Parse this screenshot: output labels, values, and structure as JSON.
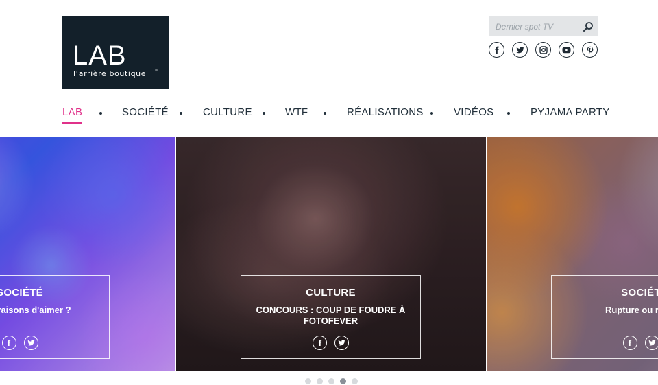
{
  "logo": {
    "main": "LAB",
    "sub": "l’arrière boutique",
    "reg": "®",
    "bg": "#13202a"
  },
  "search": {
    "placeholder": "Dernier spot TV",
    "icon": "search-icon"
  },
  "social": [
    "facebook-icon",
    "twitter-icon",
    "instagram-icon",
    "youtube-icon",
    "pinterest-icon"
  ],
  "nav": {
    "items": [
      {
        "label": "LAB",
        "active": true
      },
      {
        "label": "SOCIÉTÉ"
      },
      {
        "label": "CULTURE"
      },
      {
        "label": "WTF"
      },
      {
        "label": "RÉALISATIONS"
      },
      {
        "label": "VIDÉOS"
      },
      {
        "label": "PYJAMA PARTY"
      }
    ],
    "accent": "#e0318a"
  },
  "slides": [
    {
      "category": "SOCIÉTÉ",
      "title": "onnes raisons d'aimer ?"
    },
    {
      "category": "CULTURE",
      "title": "CONCOURS : COUP DE FOUDRE À FOTOFEVER"
    },
    {
      "category": "SOCIÉT",
      "title": "Rupture ou renai"
    }
  ],
  "pagination": {
    "count": 5,
    "active_index": 3
  }
}
